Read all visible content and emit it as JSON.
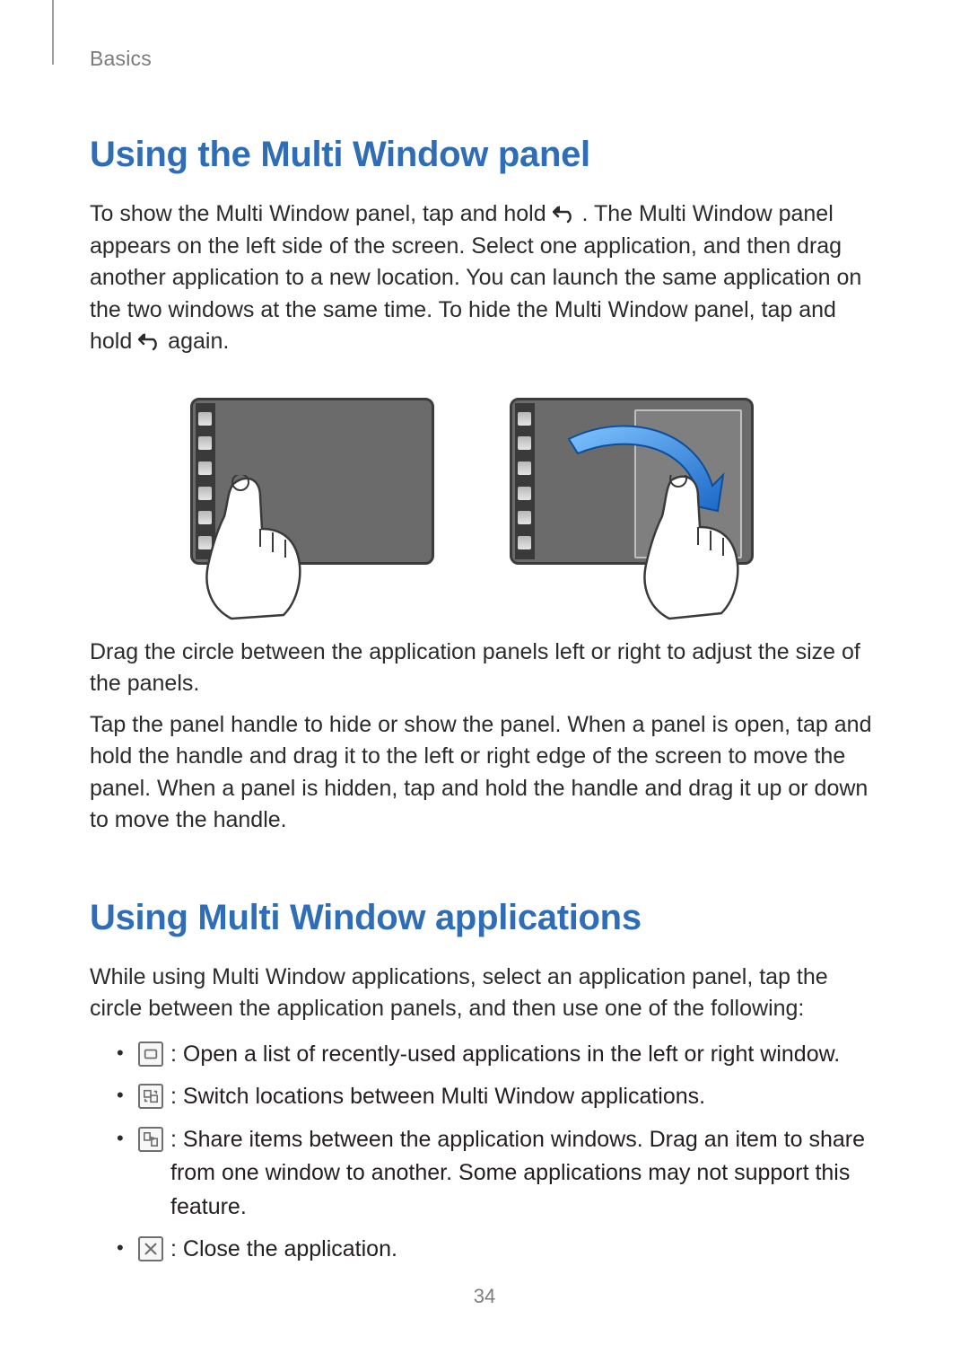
{
  "breadcrumb": "Basics",
  "section1": {
    "heading": "Using the Multi Window panel",
    "p1a": "To show the Multi Window panel, tap and hold ",
    "p1b": ". The Multi Window panel appears on the left side of the screen. Select one application, and then drag another application to a new location. You can launch the same application on the two windows at the same time. To hide the Multi Window panel, tap and hold ",
    "p1c": " again.",
    "p2": "Drag the circle between the application panels left or right to adjust the size of the panels.",
    "p3": "Tap the panel handle to hide or show the panel. When a panel is open, tap and hold the handle and drag it to the left or right edge of the screen to move the panel. When a panel is hidden, tap and hold the handle and drag it up or down to move the handle."
  },
  "section2": {
    "heading": "Using Multi Window applications",
    "p1": "While using Multi Window applications, select an application panel, tap the circle between the application panels, and then use one of the following:",
    "bullets": [
      " : Open a list of recently-used applications in the left or right window.",
      " : Switch locations between Multi Window applications.",
      " : Share items between the application windows. Drag an item to share from one window to another. Some applications may not support this feature.",
      " : Close the application."
    ]
  },
  "icons": {
    "back": "back-icon",
    "recent": "recent-apps-icon",
    "switch": "switch-locations-icon",
    "share": "share-items-icon",
    "close": "close-icon"
  },
  "page_number": "34"
}
